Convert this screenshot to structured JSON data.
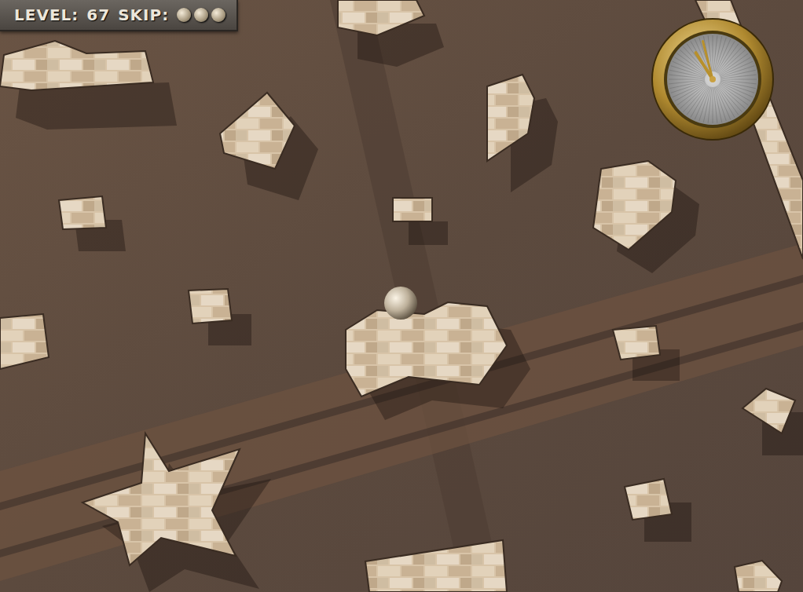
{
  "hud": {
    "level_label": "LEVEL:",
    "level": "67",
    "skip_label": "SKIP:",
    "skips": [
      {
        "available": true
      },
      {
        "available": true
      },
      {
        "available": true
      }
    ]
  },
  "timer": {
    "level": 0.96
  }
}
